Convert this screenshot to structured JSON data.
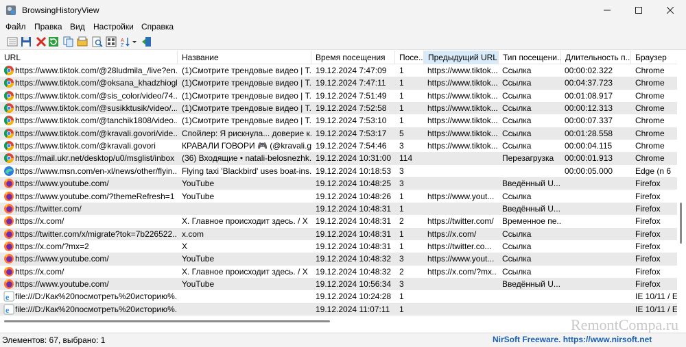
{
  "window": {
    "title": "BrowsingHistoryView"
  },
  "menu": [
    "Файл",
    "Правка",
    "Вид",
    "Настройки",
    "Справка"
  ],
  "columns": [
    "URL",
    "Название",
    "Время посещения",
    "Посе...",
    "Предыдущий URL",
    "Тип посещени...",
    "Длительность п...",
    "Браузер"
  ],
  "rows": [
    {
      "browser": "Chrome",
      "cells": [
        "https://www.tiktok.com/@28ludmila_/live?en...",
        "(1)Смотрите трендовые видео | T...",
        "19.12.2024 7:47:09",
        "1",
        "https://www.tiktok...",
        "Ссылка",
        "00:00:02.322",
        "Chrome"
      ]
    },
    {
      "browser": "Chrome",
      "cells": [
        "https://www.tiktok.com/@oksana_khadzhiogl...",
        "(1)Смотрите трендовые видео | T...",
        "19.12.2024 7:47:11",
        "1",
        "https://www.tiktok...",
        "Ссылка",
        "00:04:37.723",
        "Chrome"
      ]
    },
    {
      "browser": "Chrome",
      "cells": [
        "https://www.tiktok.com/@sis_color/video/74...",
        "(1)Смотрите трендовые видео | T...",
        "19.12.2024 7:51:49",
        "1",
        "https://www.tiktok...",
        "Ссылка",
        "00:01:08.917",
        "Chrome"
      ]
    },
    {
      "browser": "Chrome",
      "cells": [
        "https://www.tiktok.com/@susikktusik/video/...",
        "(1)Смотрите трендовые видео | T...",
        "19.12.2024 7:52:58",
        "1",
        "https://www.tiktok...",
        "Ссылка",
        "00:00:12.313",
        "Chrome"
      ]
    },
    {
      "browser": "Chrome",
      "cells": [
        "https://www.tiktok.com/@tanchik1808/video...",
        "(1)Смотрите трендовые видео | T...",
        "19.12.2024 7:53:10",
        "1",
        "https://www.tiktok...",
        "Ссылка",
        "00:00:07.337",
        "Chrome"
      ]
    },
    {
      "browser": "Chrome",
      "cells": [
        "https://www.tiktok.com/@kravali.govori/vide...",
        "Спойлер: Я рискнула... доверие к...",
        "19.12.2024 7:53:17",
        "5",
        "https://www.tiktok...",
        "Ссылка",
        "00:01:28.558",
        "Chrome"
      ]
    },
    {
      "browser": "Chrome",
      "cells": [
        "https://www.tiktok.com/@kravali.govori",
        "КРАВАЛИ ГОВОРИ 🎮 (@kravali.g...",
        "19.12.2024 7:54:46",
        "3",
        "https://www.tiktok...",
        "Ссылка",
        "00:00:04.115",
        "Chrome"
      ]
    },
    {
      "browser": "Chrome",
      "cells": [
        "https://mail.ukr.net/desktop/u0/msglist/inbox",
        "(36) Входящие • natali-belosnezhk...",
        "19.12.2024 10:31:00",
        "114",
        "",
        "Перезагрузка",
        "00:00:01.913",
        "Chrome"
      ]
    },
    {
      "browser": "Edge",
      "cells": [
        "https://www.msn.com/en-xl/news/other/flyin...",
        "Flying taxi 'Blackbird' uses boat-ins...",
        "19.12.2024 10:18:53",
        "3",
        "",
        "",
        "00:00:05.000",
        "Edge (n 6"
      ]
    },
    {
      "browser": "Firefox",
      "cells": [
        "https://www.youtube.com/",
        "YouTube",
        "19.12.2024 10:48:25",
        "3",
        "",
        "Введённый U...",
        "",
        "Firefox"
      ]
    },
    {
      "browser": "Firefox",
      "cells": [
        "https://www.youtube.com/?themeRefresh=1",
        "YouTube",
        "19.12.2024 10:48:26",
        "1",
        "https://www.yout...",
        "Ссылка",
        "",
        "Firefox"
      ]
    },
    {
      "browser": "Firefox",
      "cells": [
        "https://twitter.com/",
        "",
        "19.12.2024 10:48:31",
        "1",
        "",
        "Введённый U...",
        "",
        "Firefox"
      ]
    },
    {
      "browser": "Firefox",
      "cells": [
        "https://x.com/",
        "X. Главное происходит здесь. / X",
        "19.12.2024 10:48:31",
        "2",
        "https://twitter.com/",
        "Временное пе...",
        "",
        "Firefox"
      ]
    },
    {
      "browser": "Firefox",
      "cells": [
        "https://twitter.com/x/migrate?tok=7b226522...",
        "x.com",
        "19.12.2024 10:48:31",
        "1",
        "https://x.com/",
        "Ссылка",
        "",
        "Firefox"
      ]
    },
    {
      "browser": "Firefox",
      "cells": [
        "https://x.com/?mx=2",
        "X",
        "19.12.2024 10:48:31",
        "1",
        "https://twitter.co...",
        "Ссылка",
        "",
        "Firefox"
      ]
    },
    {
      "browser": "Firefox",
      "cells": [
        "https://www.youtube.com/",
        "YouTube",
        "19.12.2024 10:48:32",
        "3",
        "https://www.yout...",
        "Ссылка",
        "",
        "Firefox"
      ]
    },
    {
      "browser": "Firefox",
      "cells": [
        "https://x.com/",
        "X. Главное происходит здесь. / X",
        "19.12.2024 10:48:32",
        "2",
        "https://x.com/?mx...",
        "Ссылка",
        "",
        "Firefox"
      ]
    },
    {
      "browser": "Firefox",
      "cells": [
        "https://www.youtube.com/",
        "YouTube",
        "19.12.2024 10:56:34",
        "3",
        "",
        "Введённый U...",
        "",
        "Firefox"
      ]
    },
    {
      "browser": "IE",
      "cells": [
        "file:///D:/Как%20посмотреть%20историю%...",
        "",
        "19.12.2024 10:24:28",
        "1",
        "",
        "",
        "",
        "IE 10/11 / E"
      ]
    },
    {
      "browser": "IE",
      "cells": [
        "file:///D:/Как%20посмотреть%20историю%...",
        "",
        "19.12.2024 11:07:11",
        "1",
        "",
        "",
        "",
        "IE 10/11 / E"
      ]
    }
  ],
  "status": {
    "count": "Элементов: 67, выбрано: 1",
    "link": "NirSoft Freeware. https://www.nirsoft.net"
  },
  "watermark": "RemontCompa.ru",
  "colors": {
    "link_blue": "#1a5fb4",
    "alt_row": "#e9e9e9",
    "sorted_header": "#d9ebf9"
  }
}
